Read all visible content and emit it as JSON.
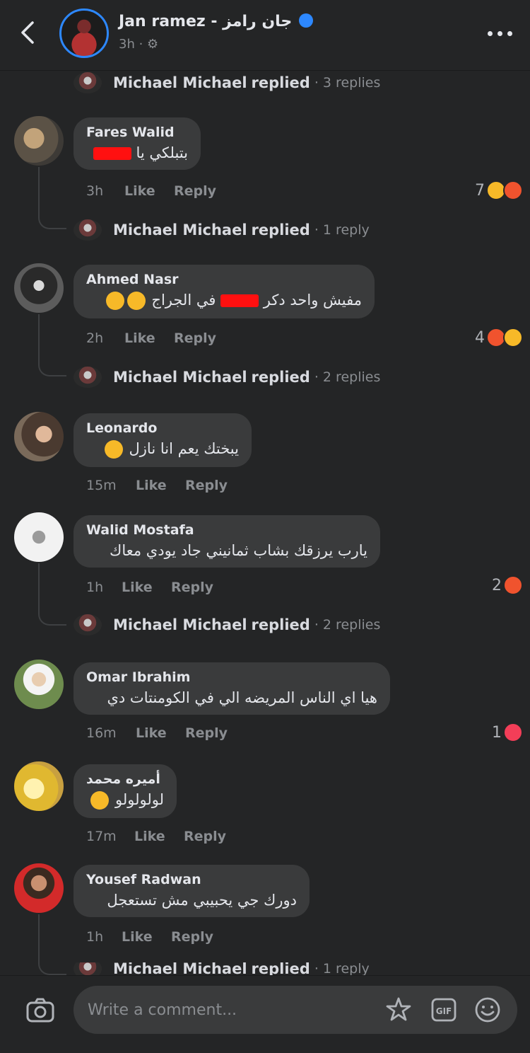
{
  "header": {
    "name": "Jan ramez - جان رامز",
    "meta": "3h · ⚙"
  },
  "comments": [
    {
      "name": "Fares Walid",
      "text": "بتبلكي يا",
      "time": "3h",
      "like": "Like",
      "reply": "Reply",
      "reaction_count": "7",
      "replied": {
        "name": "Michael Michael",
        "action": "replied",
        "count": "· 1 reply"
      }
    },
    {
      "name": "Ahmed Nasr",
      "text": "مفيش واحد دكر",
      "text2": "في الجراج",
      "time": "2h",
      "like": "Like",
      "reply": "Reply",
      "reaction_count": "4",
      "replied": {
        "name": "Michael Michael",
        "action": "replied",
        "count": "· 2 replies"
      }
    },
    {
      "name": "Leonardo",
      "text": "يبختك يعم انا نازل",
      "time": "15m",
      "like": "Like",
      "reply": "Reply"
    },
    {
      "name": "Walid Mostafa",
      "text": "يارب يرزقك بشاب ثمانيني جاد يودي معاك",
      "time": "1h",
      "like": "Like",
      "reply": "Reply",
      "reaction_count": "2",
      "replied": {
        "name": "Michael Michael",
        "action": "replied",
        "count": "· 2 replies"
      }
    },
    {
      "name": "Omar Ibrahim",
      "text": "هيا اي الناس المريضه الي في الكومنتات دي",
      "time": "16m",
      "like": "Like",
      "reply": "Reply",
      "reaction_count": "1"
    },
    {
      "name": "أميره محمد",
      "text": "لولولولو",
      "time": "17m",
      "like": "Like",
      "reply": "Reply"
    },
    {
      "name": "Yousef Radwan",
      "text": "دورك جي يحبيبي مش تستعجل",
      "time": "1h",
      "like": "Like",
      "reply": "Reply",
      "replied": {
        "name": "Michael Michael",
        "action": "replied",
        "count": "· 1 reply"
      }
    }
  ],
  "top_replied": {
    "name": "Michael Michael",
    "action": "replied",
    "count": "· 3 replies"
  },
  "composer": {
    "placeholder": "Write a comment..."
  },
  "colors": {
    "accent": "#2d88ff",
    "background": "#242526",
    "bubble": "#3a3b3c",
    "censor": "#ff1010"
  }
}
